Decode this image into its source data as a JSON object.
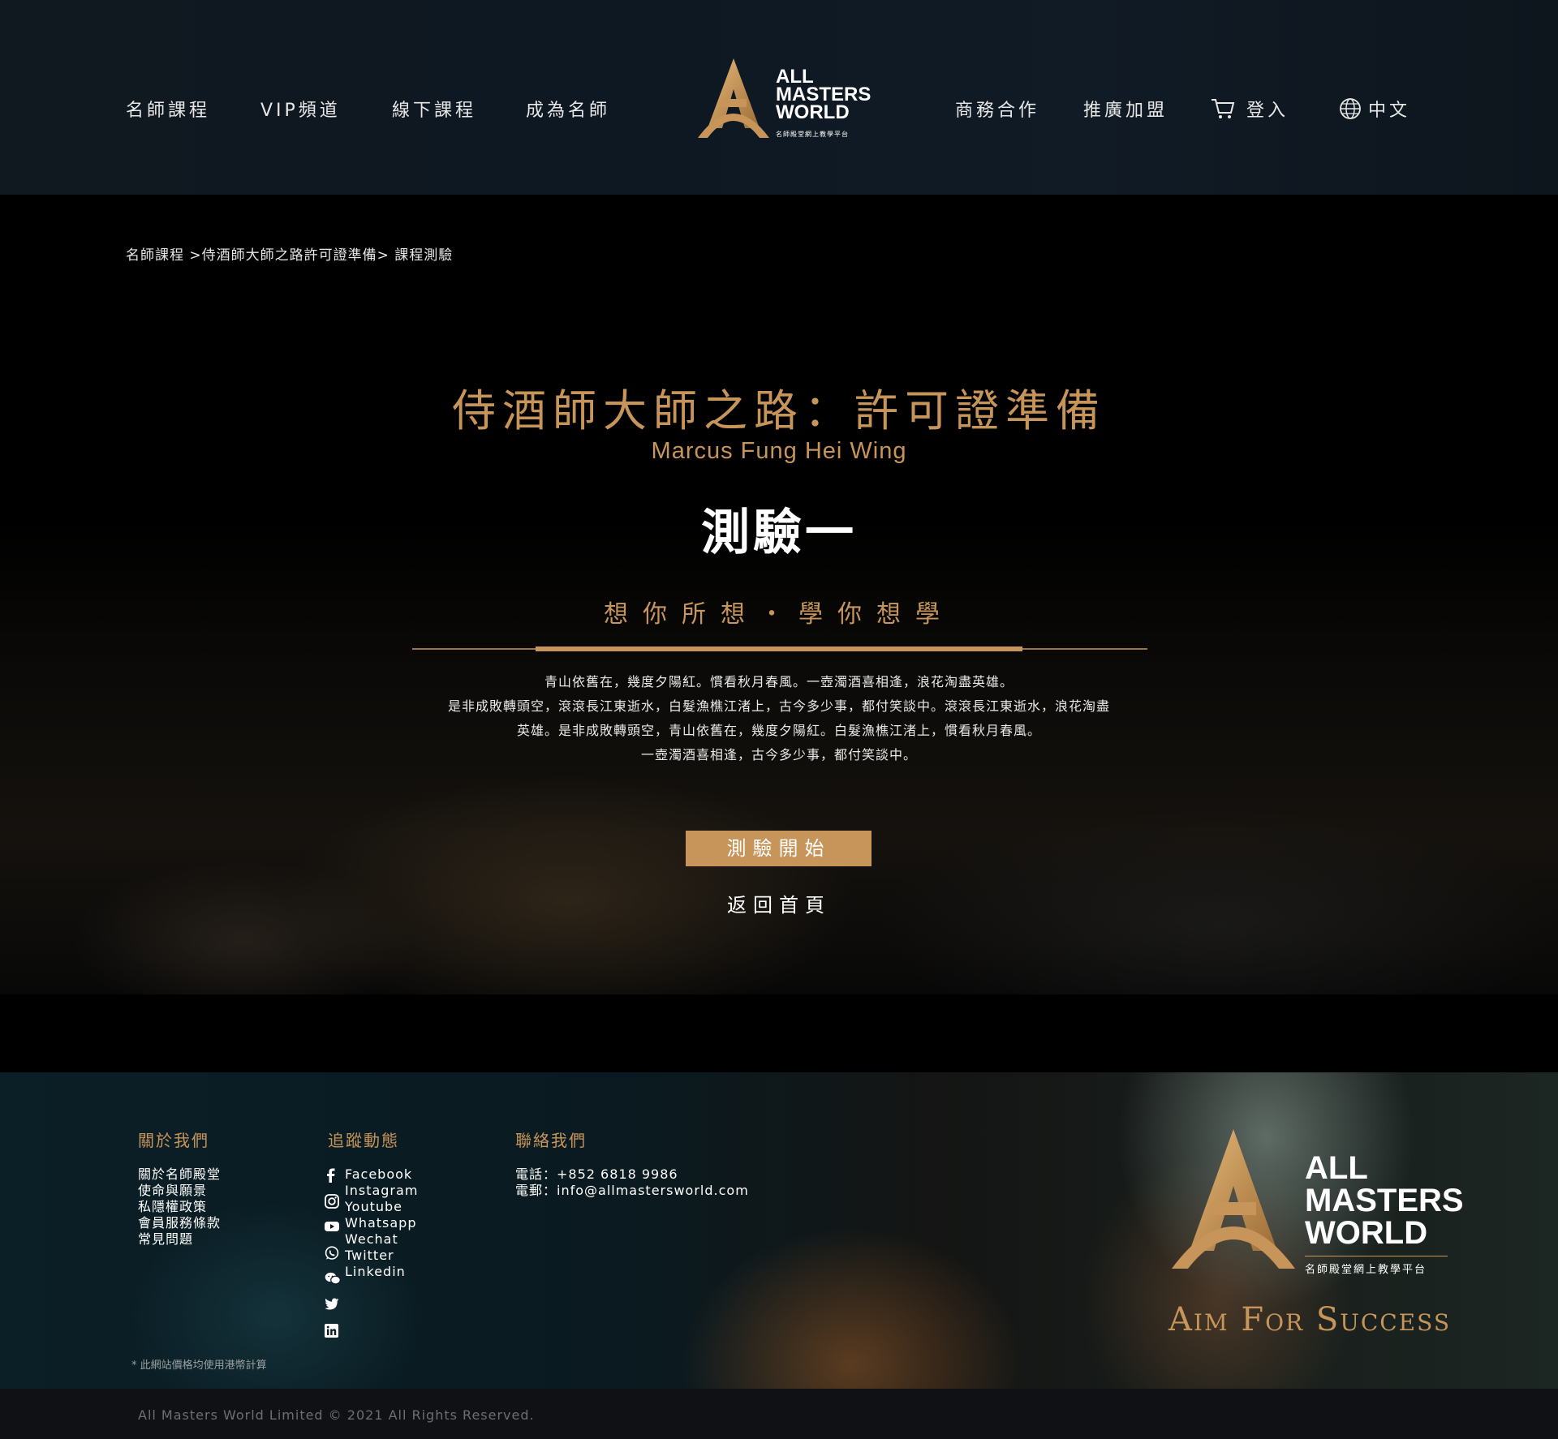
{
  "header": {
    "nav_left": [
      "名師課程",
      "VIP頻道",
      "線下課程",
      "成為名師"
    ],
    "nav_right": {
      "business": "商務合作",
      "affiliate": "推廣加盟",
      "login": "登入",
      "language": "中文"
    },
    "logo": {
      "line1": "ALL",
      "line2": "MASTERS",
      "line3": "WORLD",
      "sub": "名師殿堂網上教學平台"
    }
  },
  "main": {
    "breadcrumb": "名師課程 >侍酒師大師之路許可證準備> 課程測驗",
    "course_title": "侍酒師大師之路：許可證準備",
    "teacher": "Marcus Fung Hei Wing",
    "quiz_title": "測驗一",
    "slogan": "想你所想・學你想學",
    "description": [
      "青山依舊在，幾度夕陽紅。慣看秋月春風。一壺濁酒喜相逢，浪花淘盡英雄。",
      "是非成敗轉頭空，滾滾長江東逝水，白髮漁樵江渚上，古今多少事，都付笑談中。滾滾長江東逝水，浪花淘盡",
      "英雄。是非成敗轉頭空，青山依舊在，幾度夕陽紅。白髮漁樵江渚上，慣看秋月春風。",
      "一壺濁酒喜相逢，古今多少事，都付笑談中。"
    ],
    "start_button": "測驗開始",
    "home_link": "返回首頁"
  },
  "footer": {
    "about": {
      "heading": "關於我們",
      "items": [
        "關於名師殿堂",
        "使命與願景",
        "私隱權政策",
        "會員服務條款",
        "常見問題"
      ]
    },
    "follow": {
      "heading": "追蹤動態",
      "items": [
        "Facebook",
        "Instagram",
        "Youtube",
        "Whatsapp",
        "Wechat",
        "Twitter",
        "Linkedin"
      ],
      "icons": [
        "facebook-icon",
        "instagram-icon",
        "youtube-icon",
        "whatsapp-icon",
        "wechat-icon",
        "twitter-icon",
        "linkedin-icon"
      ]
    },
    "contact": {
      "heading": "聯絡我們",
      "phone": "電話：+852 6818 9986",
      "email": "電郵：info@allmastersworld.com"
    },
    "note": "* 此網站價格均使用港幣計算",
    "logo": {
      "line1": "ALL",
      "line2": "MASTERS",
      "line3": "WORLD",
      "sub": "名師殿堂網上教學平台"
    },
    "motto": "Aim For Success",
    "copyright": "All Masters World Limited © 2021 All Rights Reserved."
  },
  "colors": {
    "accent_gold": "#c7955a",
    "header_bg": "#101820",
    "main_bg": "#000000"
  }
}
